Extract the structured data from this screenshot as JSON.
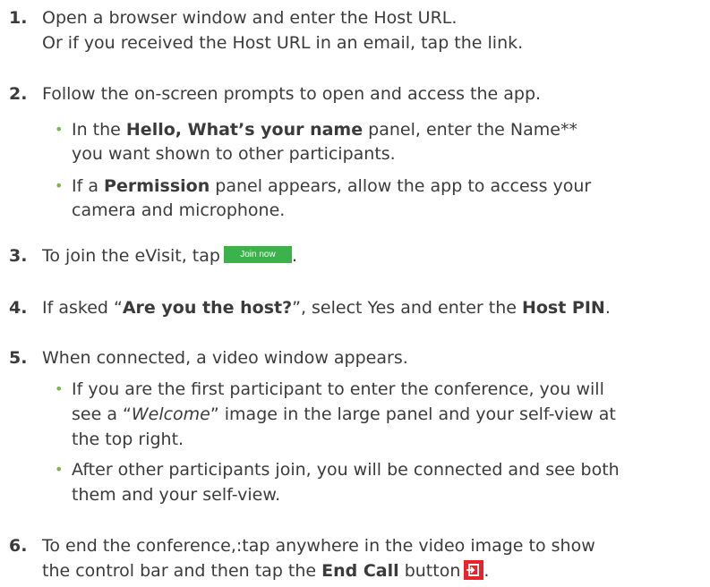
{
  "steps": [
    {
      "number": "1.",
      "lines": [
        "Open a browser window and enter the Host URL.",
        "Or if you received the Host URL in an email, tap the link."
      ]
    },
    {
      "number": "2.",
      "text": "Follow the on-screen prompts to open and access the app.",
      "bullets": [
        {
          "pre": "In the ",
          "bold": "Hello, What’s your name",
          "post": " panel, enter the Name**",
          "line2": "you want shown to other participants."
        },
        {
          "pre": "If a ",
          "bold": "Permission",
          "post": " panel appears, allow the app to access your",
          "line2": "camera and microphone."
        }
      ]
    },
    {
      "number": "3.",
      "text": "To join the eVisit, tap",
      "button_label": "Join now",
      "after": "."
    },
    {
      "number": "4.",
      "pre": "If asked “",
      "bold1": "Are you the host?",
      "mid": "”, select Yes and enter the ",
      "bold2": "Host PIN",
      "post": "."
    },
    {
      "number": "5.",
      "text": "When connected, a video window appears.",
      "bullets": [
        {
          "line1": "If you are the first participant to enter the conference, you will",
          "line2_pre": "see a “",
          "line2_italic": "Welcome",
          "line2_post": "” image in the large panel and your self-view at",
          "line3": "the top right."
        },
        {
          "line1": "After other participants join, you will be connected and see both",
          "line2": "them and your self-view."
        }
      ]
    },
    {
      "number": "6.",
      "line1": "To end the conference,:tap anywhere in the video image to show",
      "line2_pre": "the control bar and then tap the ",
      "line2_bold": "End Call",
      "line2_post": " button",
      "after": "."
    }
  ],
  "bullet_char": "•",
  "colors": {
    "text": "#3b3b3b",
    "bullet": "#7ab648",
    "join_button": "#3cb34a",
    "end_call_button": "#e8232b"
  },
  "icons": {
    "end_call": "end-call-icon"
  }
}
